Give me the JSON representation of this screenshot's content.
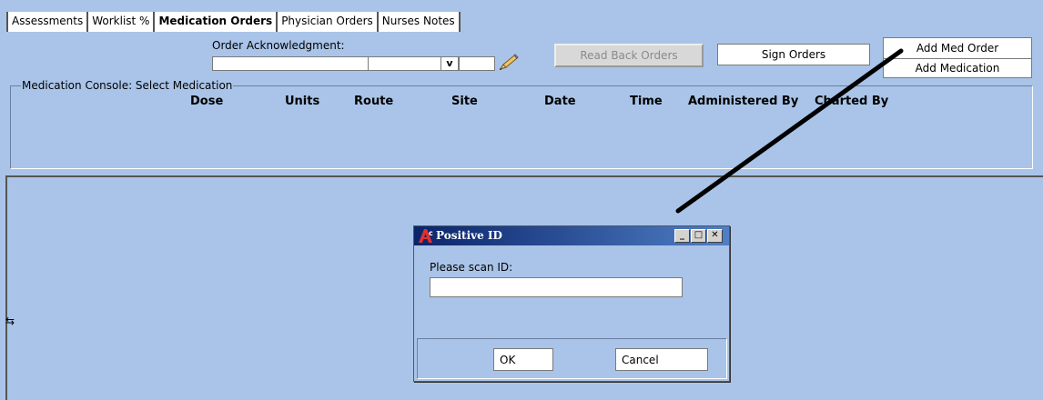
{
  "tabs": [
    {
      "label": "Assessments",
      "active": false
    },
    {
      "label": "Worklist %",
      "active": false
    },
    {
      "label": "Medication Orders",
      "active": true
    },
    {
      "label": "Physician Orders",
      "active": false
    },
    {
      "label": "Nurses Notes",
      "active": false
    }
  ],
  "order_ack": {
    "label": "Order Acknowledgment:",
    "dropdown_glyph": "v"
  },
  "buttons": {
    "read_back": "Read Back Orders",
    "sign": "Sign Orders",
    "add_med_order": "Add Med Order",
    "add_medication": "Add Medication"
  },
  "console": {
    "title": "Medication Console: Select Medication",
    "columns": [
      "Dose",
      "Units",
      "Route",
      "Site",
      "Date",
      "Time",
      "Administered By",
      "Charted By"
    ]
  },
  "dialog": {
    "title": "Positive ID",
    "label": "Please scan ID:",
    "input_value": "",
    "ok": "OK",
    "cancel": "Cancel",
    "minimize_glyph": "_",
    "maximize_glyph": "□",
    "close_glyph": "✕"
  },
  "colors": {
    "background": "#a9c4e8",
    "title_gradient_start": "#0a246a",
    "title_gradient_end": "#4f7fc6"
  }
}
